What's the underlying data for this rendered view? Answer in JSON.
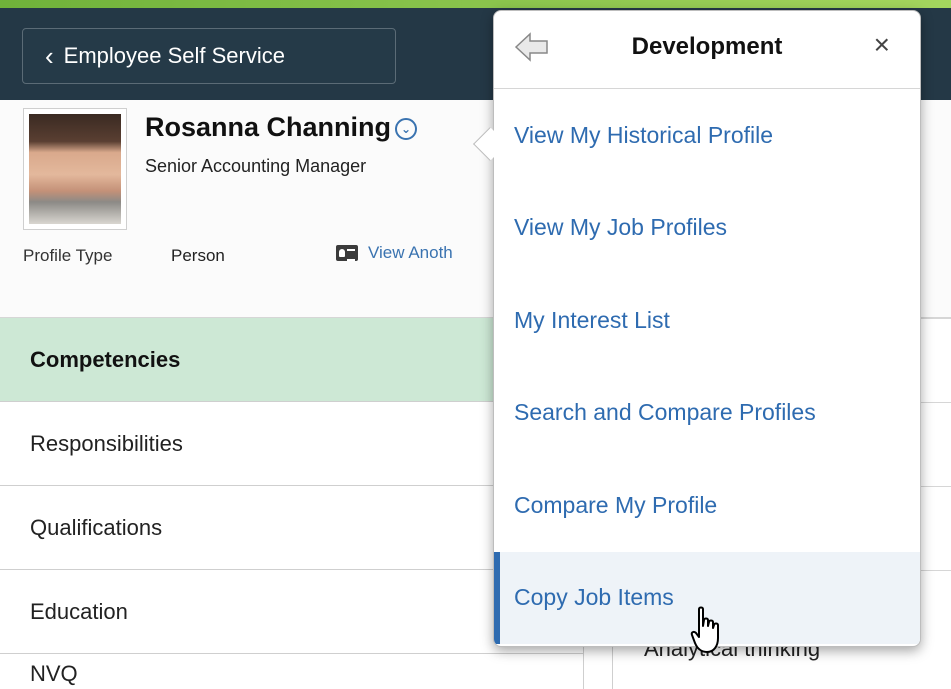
{
  "header": {
    "back_label": "Employee Self Service"
  },
  "profile": {
    "name": "Rosanna Channing",
    "job_title": "Senior Accounting Manager",
    "profile_type_label": "Profile Type",
    "profile_type_value": "Person",
    "view_another_label": "View Anoth"
  },
  "nav": {
    "items": [
      {
        "label": "Competencies"
      },
      {
        "label": "Responsibilities"
      },
      {
        "label": "Qualifications"
      },
      {
        "label": "Education"
      },
      {
        "label": "NVQ"
      }
    ]
  },
  "right_content": {
    "partial_text": "Analytical thinking"
  },
  "popup": {
    "title": "Development",
    "close_glyph": "×",
    "items": [
      {
        "label": "View My Historical Profile"
      },
      {
        "label": "View My Job Profiles"
      },
      {
        "label": "My Interest List"
      },
      {
        "label": "Search and Compare Profiles"
      },
      {
        "label": "Compare My Profile"
      },
      {
        "label": "Copy Job Items"
      }
    ]
  },
  "colors": {
    "topbar": "#243846",
    "accent_green": "#6fb23a",
    "active_nav": "#cde8d5",
    "link_blue": "#2e6bb0"
  },
  "icons": {
    "back": "chevron-left-icon",
    "dropdown": "chevron-down-circle-icon",
    "card": "id-card-icon",
    "popup_back": "arrow-left-icon",
    "close": "close-icon",
    "cursor": "hand-pointer-icon"
  }
}
